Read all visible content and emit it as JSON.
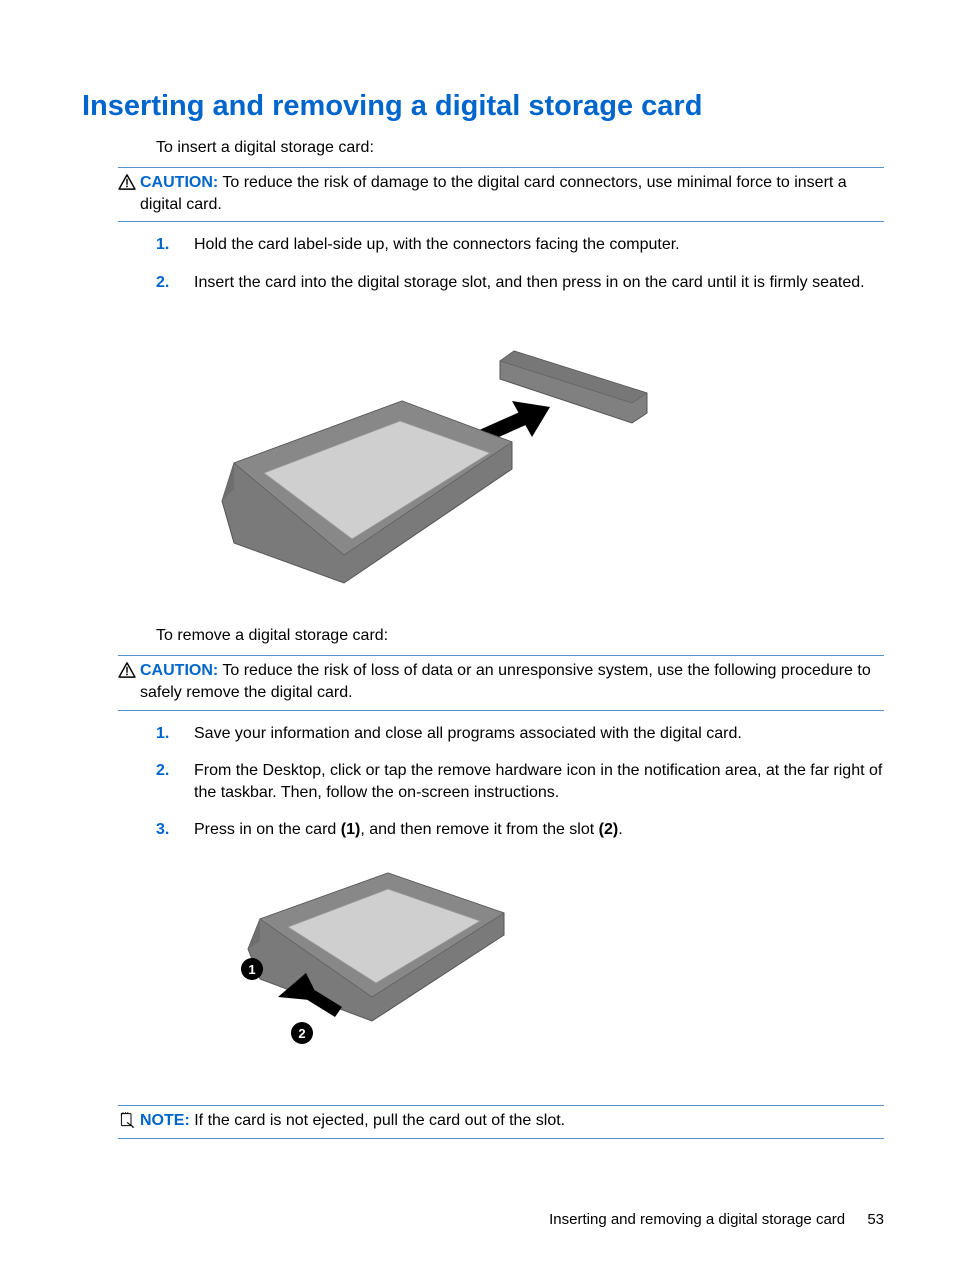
{
  "heading": "Inserting and removing a digital storage card",
  "intro_insert": "To insert a digital storage card:",
  "caution1": {
    "label": "CAUTION:",
    "text": "To reduce the risk of damage to the digital card connectors, use minimal force to insert a digital card."
  },
  "insert_steps": {
    "s1": "Hold the card label-side up, with the connectors facing the computer.",
    "s2": "Insert the card into the digital storage slot, and then press in on the card until it is firmly seated."
  },
  "intro_remove": "To remove a digital storage card:",
  "caution2": {
    "label": "CAUTION:",
    "text": "To reduce the risk of loss of data or an unresponsive system, use the following procedure to safely remove the digital card."
  },
  "remove_steps": {
    "s1": "Save your information and close all programs associated with the digital card.",
    "s2": "From the Desktop, click or tap the remove hardware icon in the notification area, at the far right of the taskbar. Then, follow the on-screen instructions.",
    "s3_pre": "Press in on the card ",
    "s3_b1": "(1)",
    "s3_mid": ", and then remove it from the slot ",
    "s3_b2": "(2)",
    "s3_post": "."
  },
  "note": {
    "label": "NOTE:",
    "text": "If the card is not ejected, pull the card out of the slot."
  },
  "footer": {
    "title": "Inserting and removing a digital storage card",
    "page": "53"
  }
}
